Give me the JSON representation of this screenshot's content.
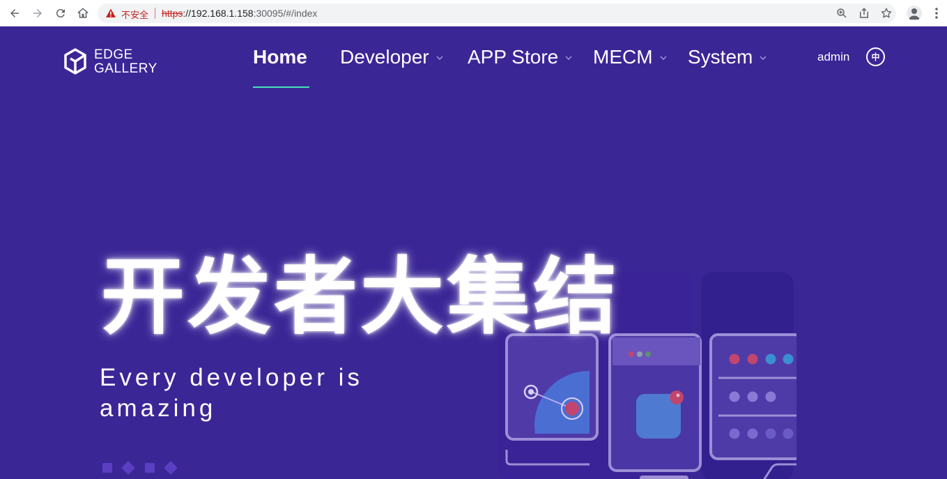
{
  "browser": {
    "security_label": "不安全",
    "url_scheme": "https",
    "url_host": "://192.168.1.158",
    "url_path": ":30095/#/index",
    "icons": [
      "back-icon",
      "forward-icon",
      "reload-icon",
      "home-icon",
      "warning-icon",
      "zoom-icon",
      "share-icon",
      "star-icon",
      "profile-icon",
      "more-icon"
    ]
  },
  "header": {
    "logo_line1": "EDGE",
    "logo_line2": "GALLERY",
    "nav": [
      {
        "label": "Home",
        "active": true
      },
      {
        "label": "Developer",
        "dropdown": true
      },
      {
        "label": "APP Store",
        "dropdown": true
      },
      {
        "label": "MECM",
        "dropdown": true
      },
      {
        "label": "System",
        "dropdown": true
      }
    ],
    "user": "admin",
    "lang": "中"
  },
  "hero": {
    "title": "开发者大集结",
    "subtitle": "Every developer is amazing"
  },
  "colors": {
    "page_bg": "#3b2696",
    "accent": "#46e2b6",
    "warning": "#c5221f"
  }
}
